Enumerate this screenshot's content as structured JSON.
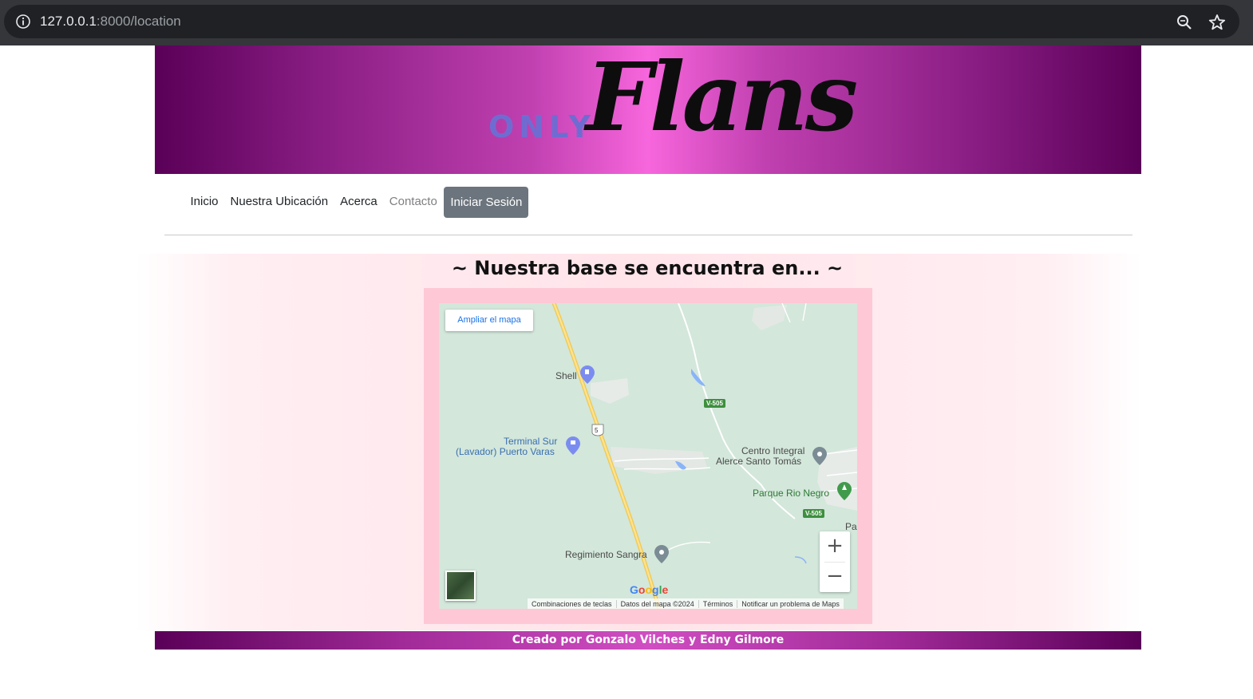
{
  "browser": {
    "url_host": "127.0.0.1",
    "url_rest": ":8000/location",
    "info_icon": "info-icon",
    "zoom_icon": "zoom-icon",
    "star_icon": "star-icon"
  },
  "header": {
    "logo_small": "ONLY",
    "logo_big": "Flans"
  },
  "nav": {
    "items": [
      "Inicio",
      "Nuestra Ubicación",
      "Acerca",
      "Contacto"
    ],
    "login": "Iniciar Sesión"
  },
  "main": {
    "title": "~ Nuestra base se encuentra en... ~"
  },
  "map": {
    "expand_label": "Ampliar el mapa",
    "places": {
      "shell": "Shell",
      "terminal_line1": "Terminal Sur",
      "terminal_line2": "(Lavador) Puerto Varas",
      "centro_line1": "Centro Integral",
      "centro_line2": "Alerce Santo Tomás",
      "parque": "Parque Rio Negro",
      "regimiento": "Regimiento Sangra",
      "pa": "Pa"
    },
    "routes": {
      "v505_a": "V-505",
      "v505_b": "V-505",
      "r5": "5"
    },
    "zoom_in": "+",
    "zoom_out": "−",
    "google": "Google",
    "attribution": [
      "Combinaciones de teclas",
      "Datos del mapa ©2024",
      "Términos",
      "Notificar un problema de Maps"
    ]
  },
  "footer": {
    "credit": "Creado por Gonzalo Vilches y Edny Gilmore"
  }
}
